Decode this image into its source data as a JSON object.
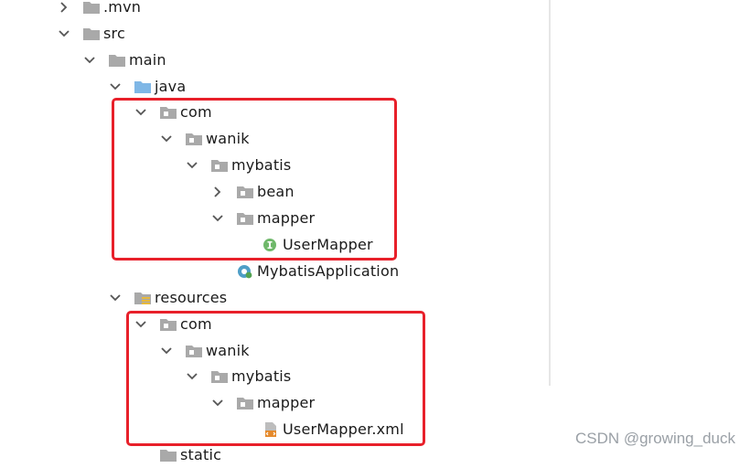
{
  "tree": {
    "rows": [
      {
        "label": ".mvn",
        "icon": "folder-icon",
        "expanded": false
      },
      {
        "label": "src",
        "icon": "folder-icon",
        "expanded": true
      },
      {
        "label": "main",
        "icon": "folder-icon",
        "expanded": true
      },
      {
        "label": "java",
        "icon": "source-folder-icon",
        "expanded": true
      },
      {
        "label": "com",
        "icon": "package-icon",
        "expanded": true
      },
      {
        "label": "wanik",
        "icon": "package-icon",
        "expanded": true
      },
      {
        "label": "mybatis",
        "icon": "package-icon",
        "expanded": true
      },
      {
        "label": "bean",
        "icon": "package-icon",
        "expanded": false
      },
      {
        "label": "mapper",
        "icon": "package-icon",
        "expanded": true
      },
      {
        "label": "UserMapper",
        "icon": "interface-icon"
      },
      {
        "label": "MybatisApplication",
        "icon": "spring-boot-class-icon"
      },
      {
        "label": "resources",
        "icon": "resources-folder-icon",
        "expanded": true
      },
      {
        "label": "com",
        "icon": "package-icon",
        "expanded": true
      },
      {
        "label": "wanik",
        "icon": "package-icon",
        "expanded": true
      },
      {
        "label": "mybatis",
        "icon": "package-icon",
        "expanded": true
      },
      {
        "label": "mapper",
        "icon": "package-icon",
        "expanded": true
      },
      {
        "label": "UserMapper.xml",
        "icon": "xml-file-icon"
      },
      {
        "label": "static",
        "icon": "folder-icon"
      }
    ]
  },
  "colors": {
    "highlight": "#e8202a",
    "folder": "#a9a9a9",
    "source_folder": "#7fb7e6",
    "interface_badge": "#6fb86a",
    "xml_badge": "#e58a2c"
  },
  "watermark": "CSDN @growing_duck"
}
